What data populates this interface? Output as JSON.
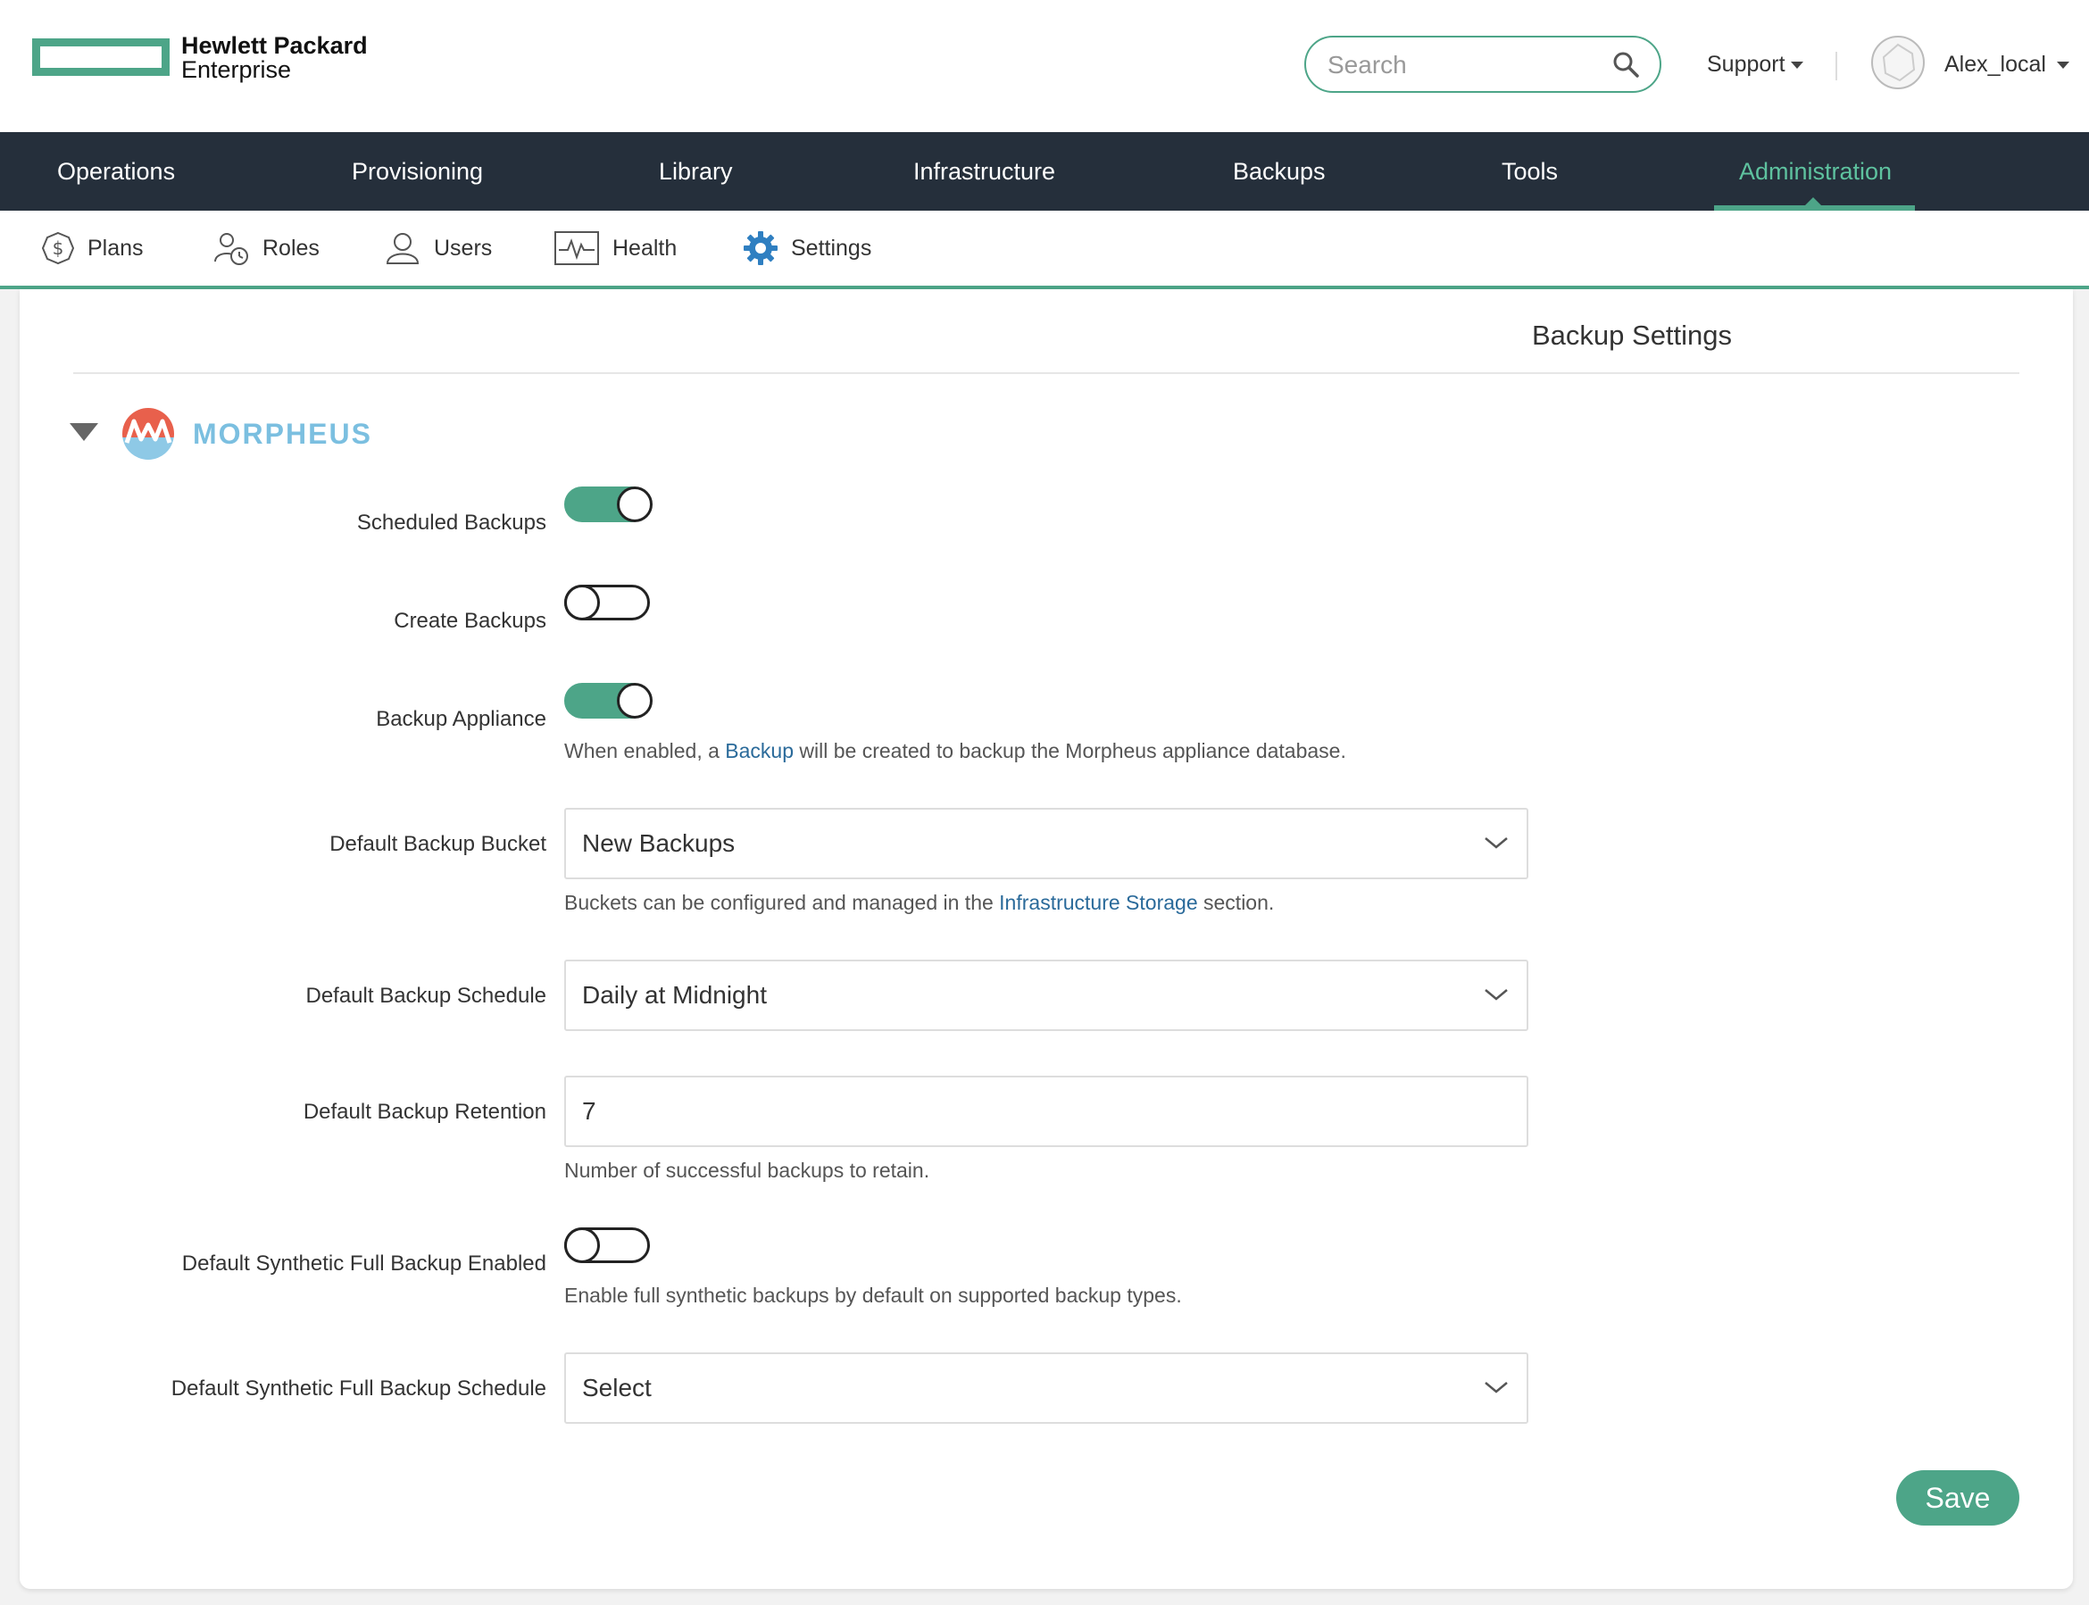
{
  "brand": {
    "line1": "Hewlett Packard",
    "line2": "Enterprise",
    "color": "#4da588"
  },
  "header": {
    "search_placeholder": "Search",
    "support_label": "Support",
    "username": "Alex_local"
  },
  "main_nav": {
    "items": [
      {
        "label": "Operations"
      },
      {
        "label": "Provisioning"
      },
      {
        "label": "Library"
      },
      {
        "label": "Infrastructure"
      },
      {
        "label": "Backups"
      },
      {
        "label": "Tools"
      },
      {
        "label": "Administration",
        "active": true
      }
    ]
  },
  "sub_nav": {
    "items": [
      {
        "label": "Plans",
        "icon": "dollar-icon"
      },
      {
        "label": "Roles",
        "icon": "roles-icon"
      },
      {
        "label": "Users",
        "icon": "user-icon"
      },
      {
        "label": "Health",
        "icon": "pulse-icon"
      },
      {
        "label": "Settings",
        "icon": "gear-icon",
        "active": true
      }
    ]
  },
  "page": {
    "title": "Backup Settings",
    "section_name": "MORPHEUS"
  },
  "form": {
    "scheduled_backups": {
      "label": "Scheduled Backups",
      "enabled": true
    },
    "create_backups": {
      "label": "Create Backups",
      "enabled": false
    },
    "backup_appliance": {
      "label": "Backup Appliance",
      "enabled": true,
      "help_before": "When enabled, a ",
      "help_link": "Backup",
      "help_after": " will be created to backup the Morpheus appliance database."
    },
    "default_bucket": {
      "label": "Default Backup Bucket",
      "value": "New Backups",
      "help_before": "Buckets can be configured and managed in the ",
      "help_link": "Infrastructure Storage",
      "help_after": " section."
    },
    "default_schedule": {
      "label": "Default Backup Schedule",
      "value": "Daily at Midnight"
    },
    "default_retention": {
      "label": "Default Backup Retention",
      "value": "7",
      "help": "Number of successful backups to retain."
    },
    "synthetic_enabled": {
      "label": "Default Synthetic Full Backup Enabled",
      "enabled": false,
      "help": "Enable full synthetic backups by default on supported backup types."
    },
    "synthetic_schedule": {
      "label": "Default Synthetic Full Backup Schedule",
      "value": "Select"
    },
    "save_label": "Save"
  }
}
